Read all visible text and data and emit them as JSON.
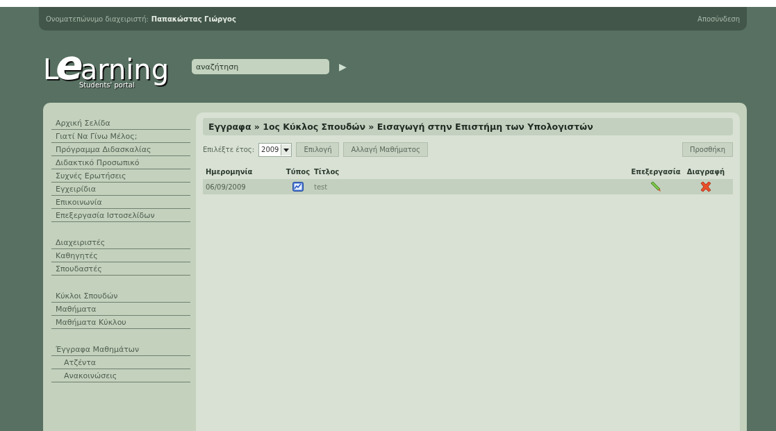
{
  "top_bar": {
    "user_label": "Ονοματεπώνυμο διαχειριστή:",
    "user_name": "Παπακώστας Γιώργος",
    "logout": "Αποσύνδεση"
  },
  "logo": {
    "first": "L",
    "big": "e",
    "rest": "arning",
    "subtitle": "Students' portal"
  },
  "search": {
    "value": "αναζήτηση",
    "go": "▶"
  },
  "sidebar": {
    "groups": [
      {
        "items": [
          {
            "label": "Αρχική Σελίδα"
          },
          {
            "label": "Γιατί Να Γίνω Μέλος;"
          },
          {
            "label": "Πρόγραμμα Διδασκαλίας"
          },
          {
            "label": "Διδακτικό Προσωπικό"
          },
          {
            "label": "Συχνές Ερωτήσεις"
          },
          {
            "label": "Εγχειρίδια"
          },
          {
            "label": "Επικοινωνία"
          },
          {
            "label": "Επεξεργασία Ιστοσελίδων"
          }
        ]
      },
      {
        "items": [
          {
            "label": "Διαχειριστές"
          },
          {
            "label": "Καθηγητές"
          },
          {
            "label": "Σπουδαστές"
          }
        ]
      },
      {
        "items": [
          {
            "label": "Κύκλοι Σπουδών"
          },
          {
            "label": "Μαθήματα"
          },
          {
            "label": "Μαθήματα Κύκλου"
          }
        ]
      },
      {
        "items": [
          {
            "label": "Έγγραφα Μαθημάτων",
            "children": [
              {
                "label": "Ατζέντα"
              },
              {
                "label": "Ανακοινώσεις"
              }
            ]
          }
        ]
      }
    ]
  },
  "main": {
    "breadcrumb": "Εγγραφα » 1ος Κύκλος Σπουδών » Εισαγωγή στην Επιστήμη των Υπολογιστών",
    "year_label": "Επιλέξτε έτος:",
    "year_value": "2009",
    "select_button": "Επιλογή",
    "change_button": "Αλλαγή Μαθήματος",
    "add_button": "Προσθήκη",
    "table": {
      "columns": [
        "Ημερομηνία",
        "Τύπος",
        "Τίτλος",
        "Επεξεργασία",
        "Διαγραφή"
      ],
      "rows": [
        {
          "date": "06/09/2009",
          "title": "test"
        }
      ]
    }
  }
}
